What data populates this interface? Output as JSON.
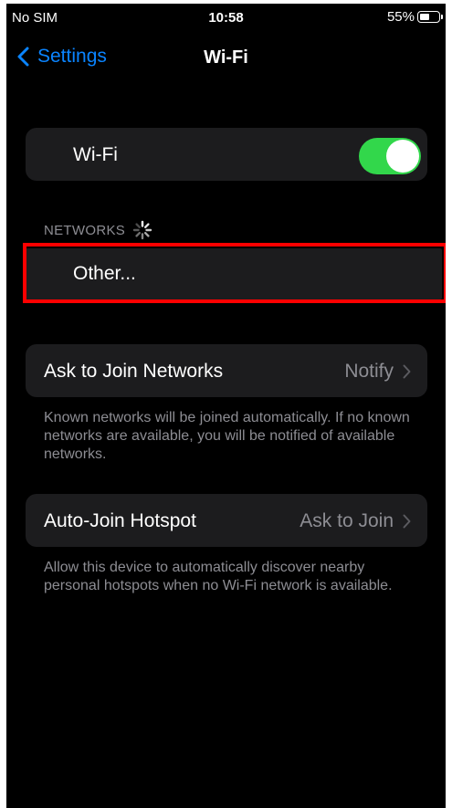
{
  "status_bar": {
    "carrier": "No SIM",
    "time": "10:58",
    "battery_percent_label": "55%",
    "battery_level": 0.55
  },
  "nav": {
    "back_label": "Settings",
    "title": "Wi-Fi"
  },
  "wifi_toggle": {
    "label": "Wi-Fi",
    "on": true
  },
  "networks_section": {
    "header": "NETWORKS",
    "other_label": "Other..."
  },
  "ask_to_join": {
    "label": "Ask to Join Networks",
    "value": "Notify",
    "footer": "Known networks will be joined automatically. If no known networks are available, you will be notified of available networks."
  },
  "auto_join_hotspot": {
    "label": "Auto-Join Hotspot",
    "value": "Ask to Join",
    "footer": "Allow this device to automatically discover nearby personal hotspots when no Wi-Fi network is available."
  },
  "colors": {
    "background": "#000000",
    "cell_background": "#1c1c1e",
    "accent_blue": "#0a84ff",
    "toggle_green": "#32d74b",
    "secondary_text": "#8d8d93",
    "highlight_red": "#ff0000"
  },
  "icons": {
    "back": "chevron-left-icon",
    "disclosure": "chevron-right-icon",
    "loading": "spinner-icon",
    "battery": "battery-icon"
  }
}
